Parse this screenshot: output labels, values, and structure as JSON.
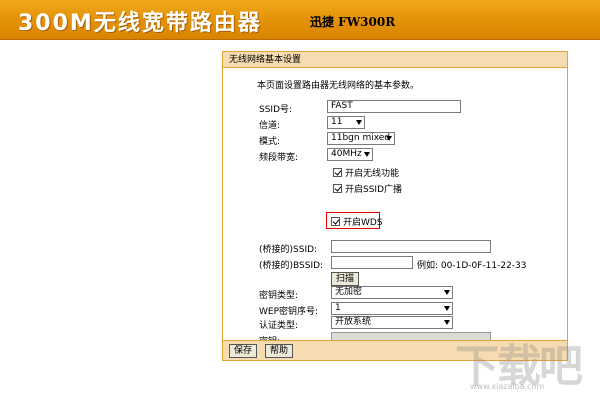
{
  "header": {
    "title": "300M无线宽带路由器",
    "model": "迅捷 FW300R",
    "bg_color": "#e8980f"
  },
  "panel": {
    "title": "无线网络基本设置",
    "description": "本页面设置路由器无线网络的基本参数。",
    "ssid": {
      "label": "SSID号:",
      "value": "FAST"
    },
    "channel": {
      "label": "信道:",
      "value": "11"
    },
    "mode": {
      "label": "模式:",
      "value": "11bgn mixed"
    },
    "bandwidth": {
      "label": "频段带宽:",
      "value": "40MHz"
    },
    "checkboxes": {
      "wireless": "开启无线功能",
      "ssid_broadcast": "开启SSID广播",
      "wds": "开启WDS"
    },
    "bridge_ssid": {
      "label": "(桥接的)SSID:",
      "value": ""
    },
    "bridge_bssid": {
      "label": "(桥接的)BSSID:",
      "value": "",
      "example": "例如: 00-1D-0F-11-22-33"
    },
    "scan_button": "扫描",
    "key_type": {
      "label": "密钥类型:",
      "value": "无加密"
    },
    "wep_index": {
      "label": "WEP密钥序号:",
      "value": "1"
    },
    "auth_type": {
      "label": "认证类型:",
      "value": "开放系统"
    },
    "key": {
      "label": "密钥:",
      "value": ""
    },
    "save_button": "保存",
    "help_button": "帮助",
    "accent_color": "#e4a23a",
    "highlight_color": "#e00000"
  },
  "watermark": {
    "text": "下载吧",
    "sub": "www.xiazaiba.com"
  }
}
